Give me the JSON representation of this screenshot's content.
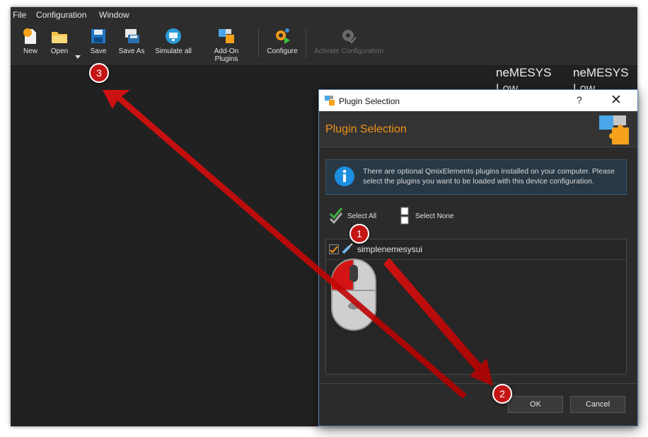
{
  "menu": {
    "file": "File",
    "configuration": "Configuration",
    "window": "Window"
  },
  "toolbar": {
    "new": "New",
    "open": "Open",
    "save": "Save",
    "save_as": "Save As",
    "simulate_all": "Simulate all",
    "add_on_plugins": "Add-On Plugins",
    "configure": "Configure",
    "activate_configuration": "Activate Configuration"
  },
  "background": {
    "panel1_line1": "neMESYS",
    "panel1_line2": "Low",
    "panel2_line1": "neMESYS",
    "panel2_line2": "Low"
  },
  "dialog": {
    "window_title": "Plugin Selection",
    "help": "?",
    "close": "✕",
    "heading": "Plugin Selection",
    "info": "There are optional QmixElements plugins installed on your computer. Please select the plugins you want to be loaded with this device configuration.",
    "select_all": "Select All",
    "select_none": "Select None",
    "plugins": [
      {
        "name": "simplenemesysui",
        "checked": true
      }
    ],
    "ok": "OK",
    "cancel": "Cancel"
  },
  "annotations": {
    "marker1": "1",
    "marker2": "2",
    "marker3": "3"
  },
  "colors": {
    "accent_orange": "#f0931a",
    "marker_red": "#c41414",
    "info_blue": "#1d8fe0"
  }
}
